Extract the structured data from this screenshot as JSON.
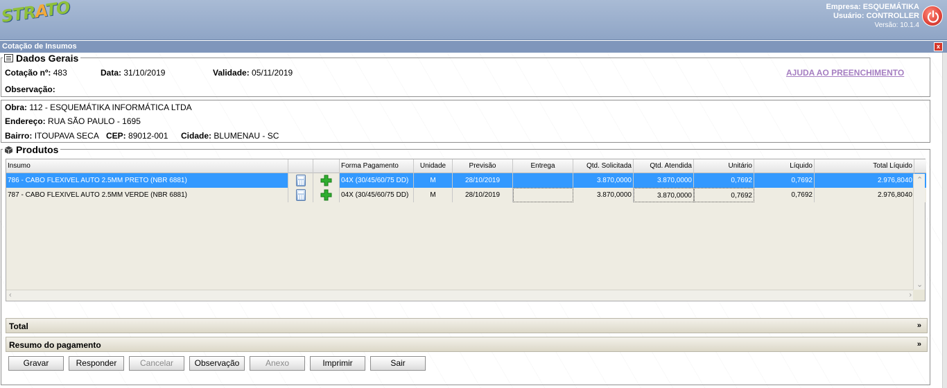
{
  "header": {
    "logo": "STRATO",
    "empresa": "Empresa: ESQUEMÁTIKA",
    "usuario": "Usuário: CONTROLLER",
    "versao": "Versão: 10.1.4"
  },
  "window": {
    "title": "Cotação de Insumos",
    "close": "x"
  },
  "dados_gerais": {
    "legend": "Dados Gerais",
    "cotacao_label": "Cotação nº:",
    "cotacao_value": "483",
    "data_label": "Data:",
    "data_value": "31/10/2019",
    "validade_label": "Validade:",
    "validade_value": "05/11/2019",
    "observacao_label": "Observação:",
    "ajuda": "AJUDA AO PREENCHIMENTO"
  },
  "obra": {
    "obra_label": "Obra:",
    "obra_value": "112 - ESQUEMÁTIKA INFORMÁTICA LTDA",
    "endereco_label": "Endereço:",
    "endereco_value": "RUA SÃO PAULO - 1695",
    "bairro_label": "Bairro:",
    "bairro_value": "ITOUPAVA SECA",
    "cep_label": "CEP:",
    "cep_value": "89012-001",
    "cidade_label": "Cidade:",
    "cidade_value": "BLUMENAU - SC"
  },
  "produtos": {
    "legend": "Produtos",
    "columns": {
      "insumo": "Insumo",
      "forma": "Forma Pagamento",
      "unidade": "Unidade",
      "previsao": "Previsão",
      "entrega": "Entrega",
      "qtd_sol": "Qtd. Solicitada",
      "qtd_at": "Qtd. Atendida",
      "unitario": "Unitário",
      "liquido": "Líquido",
      "total": "Total Líquido"
    },
    "rows": [
      {
        "insumo": "786 - CABO FLEXIVEL AUTO 2.5MM PRETO (NBR 6881)",
        "forma": "04X (30/45/60/75 DD)",
        "unidade": "M",
        "previsao": "28/10/2019",
        "entrega": "",
        "qtd_sol": "3.870,0000",
        "qtd_at": "3.870,0000",
        "unitario": "0,7692",
        "liquido": "0,7692",
        "total": "2.976,8040"
      },
      {
        "insumo": "787 - CABO FLEXIVEL AUTO 2.5MM VERDE (NBR 6881)",
        "forma": "04X (30/45/60/75 DD)",
        "unidade": "M",
        "previsao": "28/10/2019",
        "entrega": "",
        "qtd_sol": "3.870,0000",
        "qtd_at": "3.870,0000",
        "unitario": "0,7692",
        "liquido": "0,7692",
        "total": "2.976,8040"
      }
    ]
  },
  "sections": {
    "total": "Total",
    "resumo": "Resumo do pagamento",
    "chevron": "»"
  },
  "buttons": {
    "gravar": "Gravar",
    "responder": "Responder",
    "cancelar": "Cancelar",
    "observacao": "Observação",
    "anexo": "Anexo",
    "imprimir": "Imprimir",
    "sair": "Sair"
  },
  "icons": {
    "power": "power-icon",
    "calculator": "calculator-icon",
    "add": "plus-icon",
    "list": "list-icon",
    "cube": "cube-icon"
  },
  "colors": {
    "selected_row": "#3399ff",
    "add_icon": "#2fae2f",
    "ajuda_link": "#a57ec1"
  }
}
